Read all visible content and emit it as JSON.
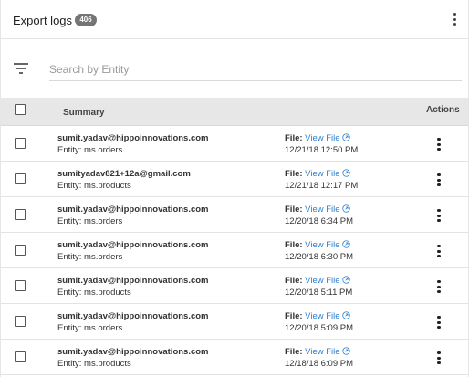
{
  "header": {
    "title": "Export logs",
    "count": "406"
  },
  "search": {
    "placeholder": "Search by Entity",
    "value": ""
  },
  "table": {
    "columns": {
      "summary": "Summary",
      "actions": "Actions"
    },
    "file_label": "File:",
    "view_label": "View File",
    "rows": [
      {
        "email": "sumit.yadav@hippoinnovations.com",
        "entity": "Entity: ms.orders",
        "date": "12/21/18 12:50 PM"
      },
      {
        "email": "sumityadav821+12a@gmail.com",
        "entity": "Entity: ms.products",
        "date": "12/21/18 12:17 PM"
      },
      {
        "email": "sumit.yadav@hippoinnovations.com",
        "entity": "Entity: ms.orders",
        "date": "12/20/18 6:34 PM"
      },
      {
        "email": "sumit.yadav@hippoinnovations.com",
        "entity": "Entity: ms.orders",
        "date": "12/20/18 6:30 PM"
      },
      {
        "email": "sumit.yadav@hippoinnovations.com",
        "entity": "Entity: ms.products",
        "date": "12/20/18 5:11 PM"
      },
      {
        "email": "sumit.yadav@hippoinnovations.com",
        "entity": "Entity: ms.orders",
        "date": "12/20/18 5:09 PM"
      },
      {
        "email": "sumit.yadav@hippoinnovations.com",
        "entity": "Entity: ms.products",
        "date": "12/18/18 6:09 PM"
      }
    ]
  },
  "colors": {
    "badge_bg": "#757575",
    "link": "#2f7fd0",
    "table_header_bg": "#e7e7e7"
  },
  "icons": {
    "header_menu": "more-vertical-icon",
    "filter": "filter-icon",
    "external_link": "external-link-icon",
    "row_menu": "more-vertical-icon"
  }
}
